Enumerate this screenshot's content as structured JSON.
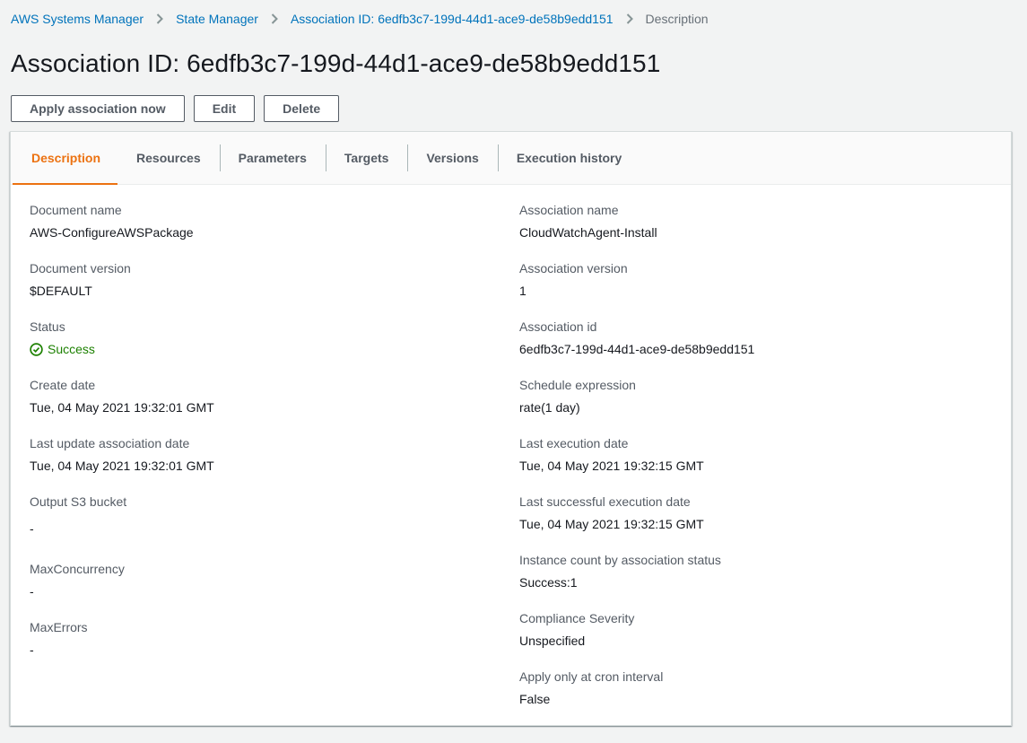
{
  "breadcrumb": {
    "items": [
      {
        "label": "AWS Systems Manager"
      },
      {
        "label": "State Manager"
      },
      {
        "label": "Association ID: 6edfb3c7-199d-44d1-ace9-de58b9edd151"
      }
    ],
    "current": "Description"
  },
  "page_title": "Association ID: 6edfb3c7-199d-44d1-ace9-de58b9edd151",
  "actions": {
    "apply": "Apply association now",
    "edit": "Edit",
    "delete": "Delete"
  },
  "tabs": [
    {
      "label": "Description",
      "active": true
    },
    {
      "label": "Resources"
    },
    {
      "label": "Parameters"
    },
    {
      "label": "Targets"
    },
    {
      "label": "Versions"
    },
    {
      "label": "Execution history"
    }
  ],
  "details": {
    "left": [
      {
        "label": "Document name",
        "value": "AWS-ConfigureAWSPackage"
      },
      {
        "label": "Document version",
        "value": "$DEFAULT"
      },
      {
        "label": "Status",
        "value": "Success",
        "status_color": "#1d8102",
        "icon": "check-circle-icon"
      },
      {
        "label": "Create date",
        "value": "Tue, 04 May 2021 19:32:01 GMT"
      },
      {
        "label": "Last update association date",
        "value": "Tue, 04 May 2021 19:32:01 GMT"
      },
      {
        "label": "Output S3 bucket",
        "value": "-"
      },
      {
        "label": "MaxConcurrency",
        "value": "-"
      },
      {
        "label": "MaxErrors",
        "value": "-"
      }
    ],
    "right": [
      {
        "label": "Association name",
        "value": "CloudWatchAgent-Install"
      },
      {
        "label": "Association version",
        "value": "1"
      },
      {
        "label": "Association id",
        "value": "6edfb3c7-199d-44d1-ace9-de58b9edd151"
      },
      {
        "label": "Schedule expression",
        "value": "rate(1 day)"
      },
      {
        "label": "Last execution date",
        "value": "Tue, 04 May 2021 19:32:15 GMT"
      },
      {
        "label": "Last successful execution date",
        "value": "Tue, 04 May 2021 19:32:15 GMT"
      },
      {
        "label": "Instance count by association status",
        "value": "Success:1"
      },
      {
        "label": "Compliance Severity",
        "value": "Unspecified"
      },
      {
        "label": "Apply only at cron interval",
        "value": "False"
      }
    ]
  },
  "colors": {
    "link": "#0073bb",
    "active_tab": "#ec7211",
    "success": "#1d8102"
  }
}
